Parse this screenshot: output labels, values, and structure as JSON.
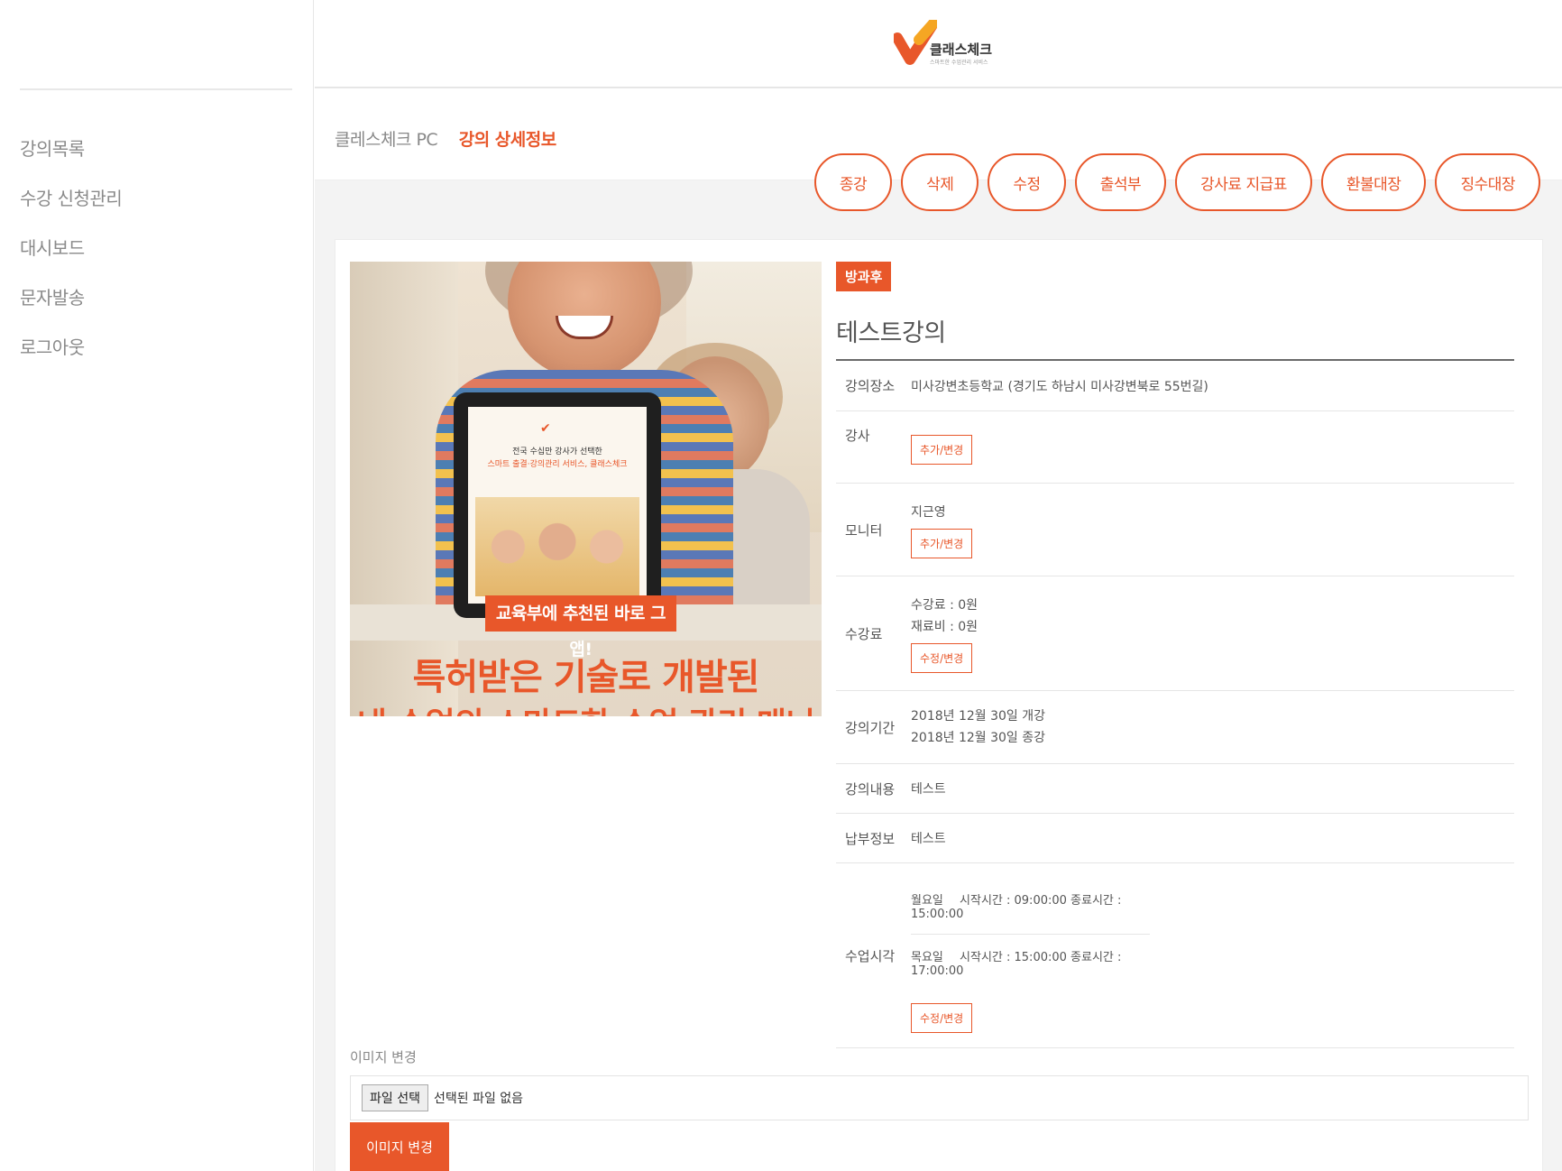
{
  "sidebar": {
    "items": [
      {
        "label": "강의목록"
      },
      {
        "label": "수강 신청관리"
      },
      {
        "label": "대시보드"
      },
      {
        "label": "문자발송"
      },
      {
        "label": "로그아웃"
      }
    ]
  },
  "header": {
    "logo_text": "클래스체크",
    "logo_sub": "스마트한 수업관리 서비스"
  },
  "breadcrumb": {
    "root": "클레스체크 PC",
    "current": "강의 상세정보"
  },
  "actions": [
    {
      "label": "종강"
    },
    {
      "label": "삭제"
    },
    {
      "label": "수정"
    },
    {
      "label": "출석부"
    },
    {
      "label": "강사료 지급표"
    },
    {
      "label": "환불대장"
    },
    {
      "label": "징수대장"
    }
  ],
  "promo": {
    "tablet_line1": "전국 수십만 강사가 선택한",
    "tablet_line2": "스마트 출결·강의관리 서비스, 클래스체크",
    "banner": "교육부에 추천된 바로 그 앱!",
    "headline": "특허받은 기술로 개발된",
    "subline": "내 수업의 스마트한 수업 관리 매니저"
  },
  "course": {
    "badge": "방과후",
    "title": "테스트강의",
    "location_label": "강의장소",
    "location": "미사강변초등학교 (경기도 하남시 미사강변북로 55번길)",
    "instructor_label": "강사",
    "instructor_btn": "추가/변경",
    "monitor_label": "모니터",
    "monitor_name": "지근영",
    "monitor_btn": "추가/변경",
    "fee_label": "수강료",
    "fee_tuition": "수강료 : 0원",
    "fee_material": "재료비 : 0원",
    "fee_btn": "수정/변경",
    "period_label": "강의기간",
    "period_start": "2018년 12월 30일 개강",
    "period_end": "2018년 12월 30일 종강",
    "content_label": "강의내용",
    "content": "테스트",
    "payment_label": "납부정보",
    "payment": "테스트",
    "schedule_label": "수업시각",
    "schedule": [
      {
        "day": "월요일",
        "time": "시작시간 : 09:00:00 종료시간 : 15:00:00"
      },
      {
        "day": "목요일",
        "time": "시작시간 : 15:00:00 종료시간 : 17:00:00"
      }
    ],
    "schedule_btn": "수정/변경"
  },
  "image_change": {
    "label": "이미지 변경",
    "file_button": "파일 선택",
    "file_status": "선택된 파일 없음",
    "submit": "이미지 변경"
  },
  "colors": {
    "accent": "#e8572a",
    "background": "#f3f3f3"
  }
}
